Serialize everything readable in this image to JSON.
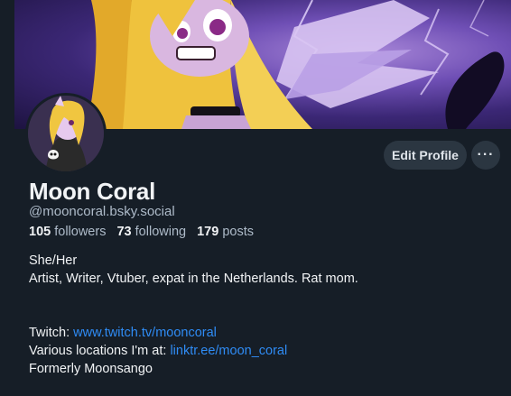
{
  "profile": {
    "display_name": "Moon Coral",
    "handle": "@mooncoral.bsky.social",
    "followers_count": "105",
    "followers_label": "followers",
    "following_count": "73",
    "following_label": "following",
    "posts_count": "179",
    "posts_label": "posts"
  },
  "actions": {
    "edit_profile_label": "Edit Profile",
    "more_label": "···"
  },
  "bio": {
    "line1": "She/Her",
    "line2": "Artist, Writer, Vtuber, expat in the Netherlands. Rat mom.",
    "twitch_prefix": "Twitch: ",
    "twitch_link": "www.twitch.tv/mooncoral",
    "locations_prefix": "Various locations I'm at: ",
    "locations_link": "linktr.ee/moon_coral",
    "line_last": "Formerly Moonsango"
  },
  "colors": {
    "background": "#161e27",
    "link": "#2f8cf5",
    "button_bg": "#2b3641",
    "muted_text": "#aebbc9"
  }
}
